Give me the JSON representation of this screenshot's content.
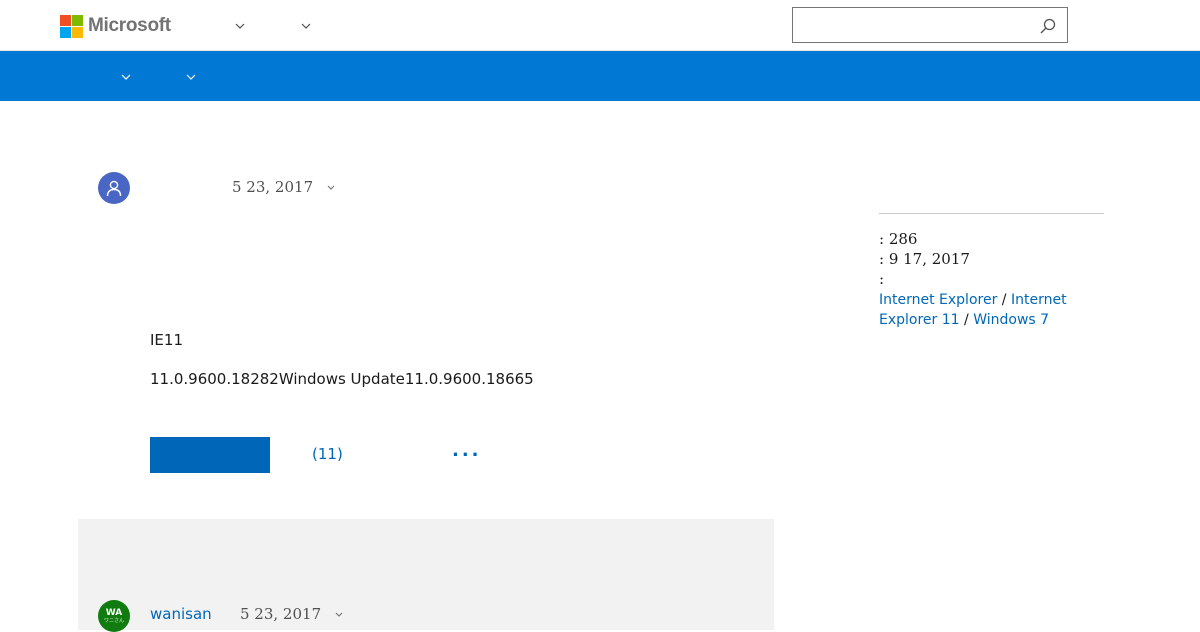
{
  "header": {
    "logo_text": "Microsoft",
    "brand_colors": [
      "#f25022",
      "#7fba00",
      "#00a4ef",
      "#ffb900"
    ],
    "search": {
      "value": "",
      "placeholder": ""
    }
  },
  "nav": {
    "color": "#0078d4"
  },
  "question": {
    "date": "5 23, 2017",
    "line1": "IE11",
    "line2": "11.0.9600.18282Windows Update11.0.9600.18665",
    "reply_count": "(11)",
    "more_label": "..."
  },
  "sidebar": {
    "views": ": 286",
    "last_updated": ": 9 17, 2017",
    "applies_to": ":",
    "tags": [
      "Internet Explorer",
      "Internet Explorer 11",
      "Windows 7"
    ],
    "tag_separator": " / "
  },
  "reply": {
    "avatar_initials": "WA",
    "avatar_sub": "ワニさん",
    "username": "wanisan",
    "date": "5 23, 2017"
  },
  "icons": [
    "microsoft-logo",
    "chevron-down-icon",
    "search-icon",
    "user-avatar-icon"
  ]
}
